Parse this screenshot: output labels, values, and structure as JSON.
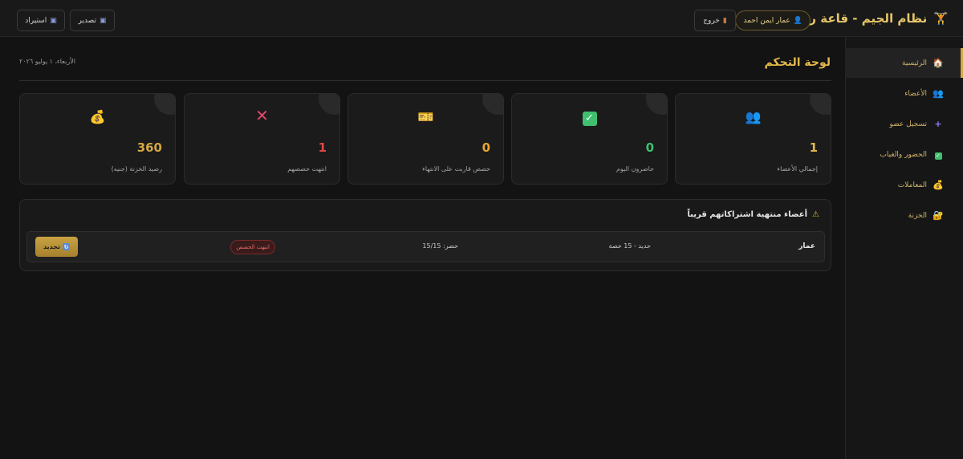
{
  "header": {
    "title": "نظام الجيم - قاعة رجال",
    "title_icon": "dumbbell-icon",
    "user_name": "عمار ايمن احمد",
    "logout_label": "خروج",
    "export_label": "تصدير",
    "import_label": "استيراد"
  },
  "sidebar": {
    "items": [
      {
        "label": "الرئيسية",
        "icon": "home-icon"
      },
      {
        "label": "الأعضاء",
        "icon": "members-icon"
      },
      {
        "label": "تسجيل عضو",
        "icon": "plus-icon"
      },
      {
        "label": "الحضور والغياب",
        "icon": "check-icon"
      },
      {
        "label": "المعاملات",
        "icon": "money-bag-icon"
      },
      {
        "label": "الخزنة",
        "icon": "safe-icon"
      }
    ]
  },
  "page": {
    "title": "لوحة التحكم",
    "date": "الأربعاء، ١ يوليو ٢٠٢٦"
  },
  "stats": [
    {
      "value": "1",
      "label": "إجمالي الأعضاء",
      "icon": "members-icon",
      "color": "#e2b84d"
    },
    {
      "value": "0",
      "label": "حاضرون اليوم",
      "icon": "check-icon",
      "color": "#3fbf6f"
    },
    {
      "value": "0",
      "label": "حصص قاربت على الانتهاء",
      "icon": "ticket-icon",
      "color": "#e8a530"
    },
    {
      "value": "1",
      "label": "انتهت حصصهم",
      "icon": "x-icon",
      "color": "#e04848"
    },
    {
      "value": "360",
      "label": "رصيد الخزنة (جنيه)",
      "icon": "money-bag-icon",
      "color": "#d4a843"
    }
  ],
  "alerts": {
    "title": "أعضاء منتهية اشتراكاتهم قريباً",
    "rows": [
      {
        "name": "عمار",
        "plan": "حديد - 15 حصة",
        "attendance": "حضر: 15/15",
        "status": "انتهت الحصص",
        "renew_label": "تجديد"
      }
    ]
  }
}
